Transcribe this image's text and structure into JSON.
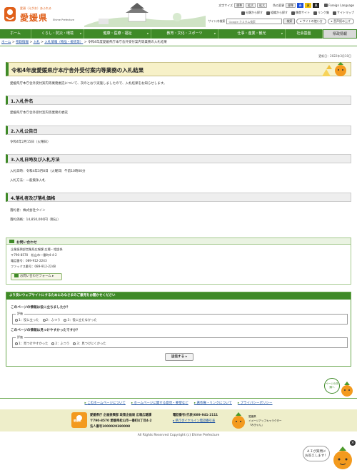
{
  "header": {
    "logo_tagline": "愛顔（えがお）あふれる",
    "logo_name": "愛媛県",
    "logo_en": "Ehime Prefecture",
    "text_size_label": "文字サイズ",
    "text_sizes": [
      "標準",
      "拡大",
      "拡大"
    ],
    "color_label": "色の変更",
    "color_std": "標準",
    "color_blue": "青",
    "color_yellow": "黄",
    "color_black": "黒",
    "foreign": "Foreign Language",
    "links": [
      "分類から探す",
      "組織から探す",
      "携帯サイト",
      "リンク集",
      "サイトマップ"
    ],
    "search_label": "サイト内検索",
    "search_placeholder": "Google カスタム検索",
    "search_button": "検索",
    "howto": "サイトの使い方",
    "readaloud": "音声読み上げ",
    "colors": {
      "brand_green": "#3f8a28",
      "blue": "#1c4fd6",
      "yellow": "#f1c40f",
      "black": "#222222"
    }
  },
  "nav": [
    "ホーム",
    "くらし・防災・環境",
    "健康・医療・福祉",
    "教育・文化・スポーツ",
    "仕事・産業・観光",
    "社会基盤",
    "県政情報"
  ],
  "breadcrumb": {
    "items": [
      "ホーム",
      "県政情報",
      "入札",
      "入札情報（物品・委託等）"
    ],
    "current": "令和4年度愛媛県庁本庁舎外受付案内等業務の入札結果",
    "sep": ">"
  },
  "page": {
    "updated": "更新日：2022年3月10日",
    "title": "令和4年度愛媛県庁本庁舎外受付案内等業務の入札結果",
    "intro": "愛媛県庁本庁舎外受付案内等業務委託について、次のとおり実施しましたので、入札結果をお知らせします。",
    "s1_title": "1.入札件名",
    "s1_text": "愛媛県庁本庁舎外受付案内等業務の委託",
    "s2_title": "2.入札公告日",
    "s2_text": "令和4年2月15日（火曜日）",
    "s3_title": "3.入札日時及び入札方法",
    "s3_text1": "入札日時：令和4年3月8日（火曜日）午前10時00分",
    "s3_text2": "入札方法：一般競争入札",
    "s4_title": "4.落札者及び落札価格",
    "s4_text1": "落札者：株式会社ウイン",
    "s4_text2": "落札価格：14,850,000円（税込）"
  },
  "contact": {
    "head": "お問い合わせ",
    "lines": [
      "企業振興部営業局広報課 広聴・相談係",
      "〒790-8570　松山市一番町4-4-2",
      "電話番号：089-912-2243",
      "ファックス番号：089-912-2248"
    ],
    "form_button": "お問い合わせフォーム"
  },
  "survey": {
    "head": "より良いウェブサイトにするためにみなさまのご意見をお聞かせください",
    "q1": "このページの情報は役に立ちましたか？",
    "q1_legend": "評価",
    "q1_options": [
      "1：役に立った",
      "2：ふつう",
      "3：役に立たなかった"
    ],
    "q2": "このページの情報は見つけやすかったですか？",
    "q2_legend": "評価",
    "q2_options": [
      "1：見つけやすかった",
      "2：ふつう",
      "3：見つけにくかった"
    ],
    "submit": "送信する"
  },
  "pagetop": "ページの先頭へ",
  "footer_links": [
    "このホームページについて",
    "ホームページに関する意見・要望など",
    "著作権・リンクについて",
    "プライバシーポリシー"
  ],
  "footer": {
    "logo_text": "愛媛県",
    "org": "愛媛県庁 企画振興部 政策企画局 広報広聴課",
    "address": "〒790-8570 愛媛県松山市一番町4丁目4-2",
    "corp_no": "法人番号1000020380008",
    "tel": "電話番号(代表)089-941-2111",
    "dial": "県庁ダイヤルイン電話番号表",
    "mascot_caption_1": "愛媛県",
    "mascot_caption_2": "イメージアップキャラクター",
    "mascot_caption_3": "「みきゃん」"
  },
  "copyright": "All Rights Reserved Copyright (c) Ehime Prefecture",
  "ai": {
    "line1": "ＡＩが質問に",
    "line2": "お答えします！",
    "close": "×"
  }
}
